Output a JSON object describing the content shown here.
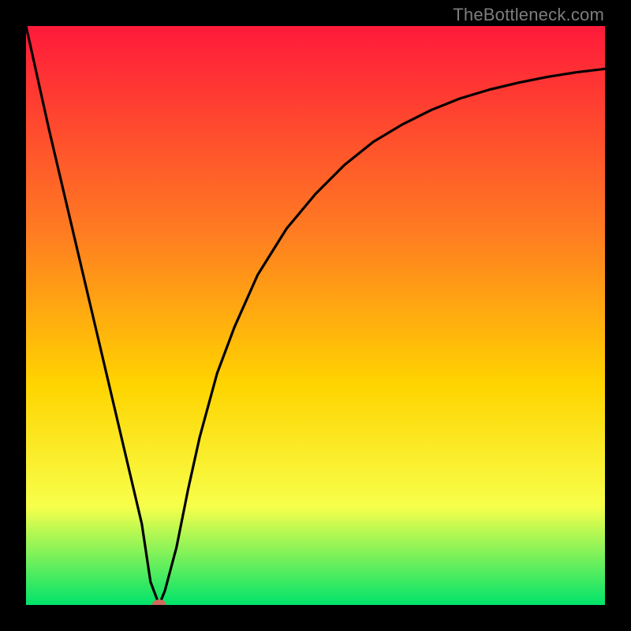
{
  "watermark": "TheBottleneck.com",
  "chart_data": {
    "type": "line",
    "title": "",
    "xlabel": "",
    "ylabel": "",
    "xlim": [
      0,
      100
    ],
    "ylim": [
      0,
      100
    ],
    "grid": false,
    "legend": false,
    "gradient": {
      "top_color": "#ff1a3a",
      "mid_upper_color": "#ff7a22",
      "mid_color": "#ffd400",
      "mid_lower_color": "#f7ff4a",
      "bottom_color": "#00e36a"
    },
    "series": [
      {
        "name": "bottleneck-curve",
        "color": "#000000",
        "x": [
          0,
          4,
          8,
          12,
          16,
          20,
          21.5,
          23,
          24,
          26,
          28,
          30,
          33,
          36,
          40,
          45,
          50,
          55,
          60,
          65,
          70,
          75,
          80,
          85,
          90,
          95,
          100
        ],
        "values": [
          100,
          82,
          65,
          48,
          31,
          14,
          4,
          0,
          2.5,
          10,
          20,
          29,
          40,
          48,
          57,
          65,
          71,
          76,
          80,
          83,
          85.5,
          87.5,
          89,
          90.2,
          91.2,
          92,
          92.6
        ]
      }
    ],
    "marker": {
      "name": "min-point",
      "x": 23,
      "y": 0,
      "color": "#cf6a5f",
      "rx": 9,
      "ry": 7
    }
  }
}
